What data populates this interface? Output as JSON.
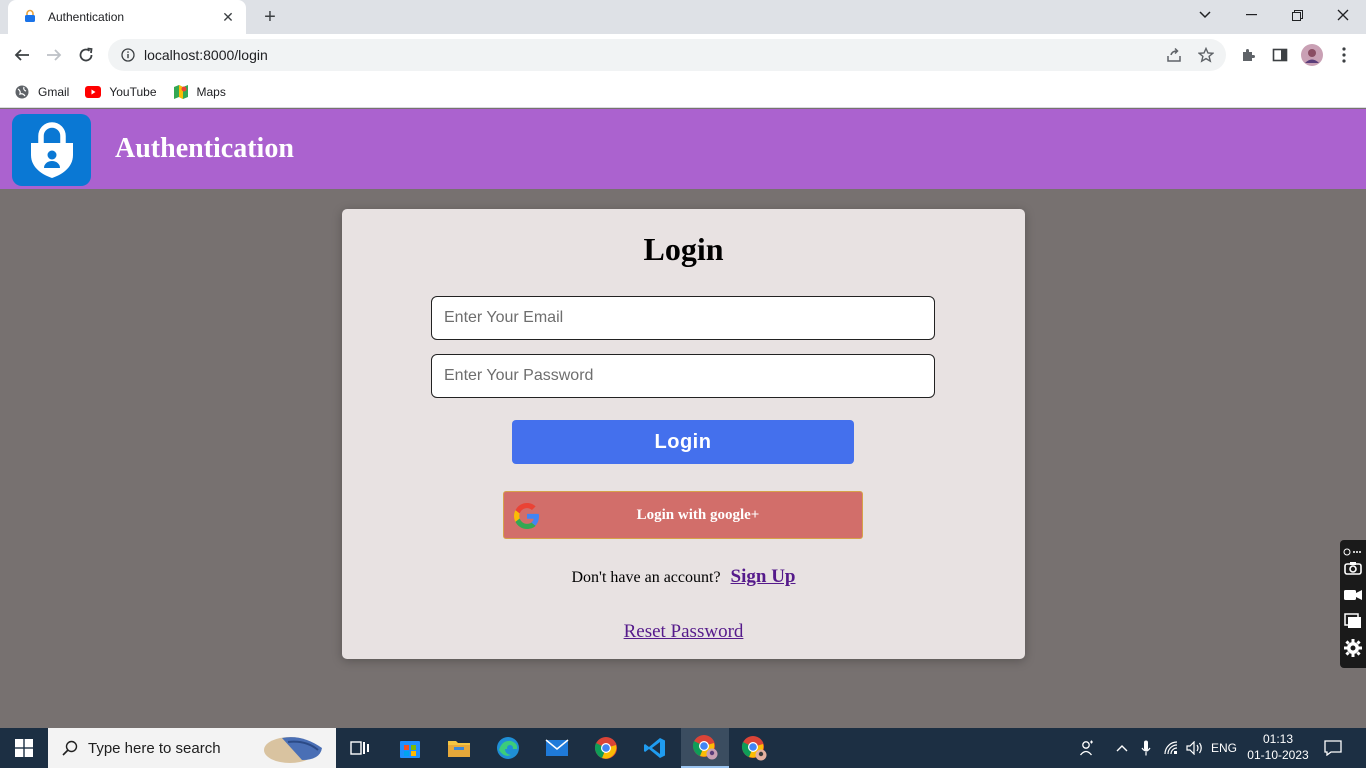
{
  "browser": {
    "tab_title": "Authentication",
    "url": "localhost:8000/login",
    "bookmarks": [
      {
        "label": "Gmail",
        "icon": "globe-icon"
      },
      {
        "label": "YouTube",
        "icon": "youtube-icon"
      },
      {
        "label": "Maps",
        "icon": "maps-icon"
      }
    ]
  },
  "header": {
    "title": "Authentication",
    "logo_icon": "lock-shield-icon",
    "background": "#ab62cf"
  },
  "login": {
    "heading": "Login",
    "email_placeholder": "Enter Your Email",
    "password_placeholder": "Enter Your Password",
    "login_button": "Login",
    "google_button": "Login with google+",
    "signup_prompt": "Don't have an account?",
    "signup_link": "Sign Up",
    "reset_link": "Reset Password",
    "accent": "#4470ed",
    "google_button_color": "#d26e6a"
  },
  "taskbar": {
    "search_placeholder": "Type here to search",
    "language": "ENG",
    "time": "01:13",
    "date": "01-10-2023"
  }
}
